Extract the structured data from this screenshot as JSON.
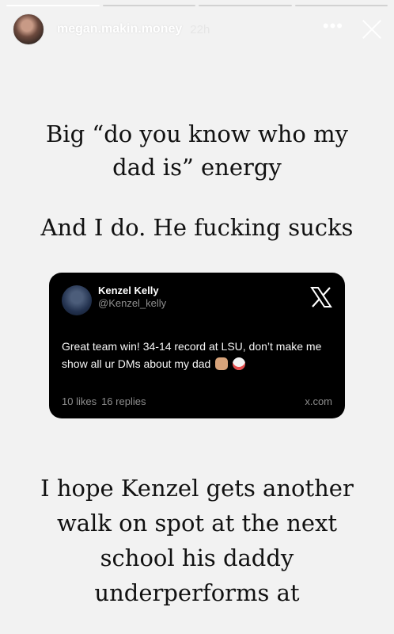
{
  "header": {
    "username": "megan.makin.money",
    "time": "22h"
  },
  "story": {
    "text1": "Big “do you know who my dad is” energy",
    "text2": "And I do. He fucking sucks",
    "text3": "I hope Kenzel gets another walk on spot at the next school his daddy underperforms at"
  },
  "tweet": {
    "name": "Kenzel Kelly",
    "handle": "@Kenzel_kelly",
    "text": "Great team win! 34-14 record at LSU, don’t make me show all ur DMs about my dad",
    "likes": "10 likes",
    "replies": "16 replies",
    "site": "x.com"
  },
  "icons": {
    "more": "more-icon",
    "close": "close-icon",
    "x_logo": "x-logo-icon"
  },
  "colors": {
    "background": "#f2f2f2",
    "tweet_card": "#000000"
  }
}
